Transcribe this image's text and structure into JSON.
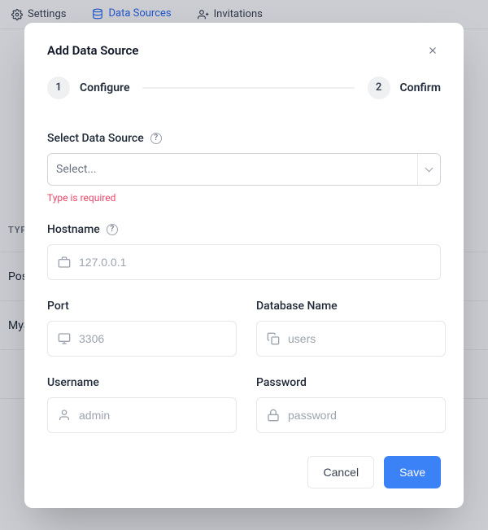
{
  "background": {
    "tabs": [
      {
        "label": "Settings"
      },
      {
        "label": "Data Sources"
      },
      {
        "label": "Invitations"
      }
    ],
    "table_header_type": "TYPE",
    "rows": [
      "PostgreSQL",
      "MySQL"
    ]
  },
  "modal": {
    "title": "Add Data Source",
    "steps": [
      {
        "num": "1",
        "label": "Configure"
      },
      {
        "num": "2",
        "label": "Confirm"
      }
    ],
    "fields": {
      "select_source": {
        "label": "Select Data Source",
        "placeholder": "Select...",
        "error": "Type is required"
      },
      "hostname": {
        "label": "Hostname",
        "placeholder": "127.0.0.1"
      },
      "port": {
        "label": "Port",
        "placeholder": "3306"
      },
      "dbname": {
        "label": "Database Name",
        "placeholder": "users"
      },
      "username": {
        "label": "Username",
        "placeholder": "admin"
      },
      "password": {
        "label": "Password",
        "placeholder": "password"
      }
    },
    "actions": {
      "cancel": "Cancel",
      "save": "Save"
    }
  }
}
